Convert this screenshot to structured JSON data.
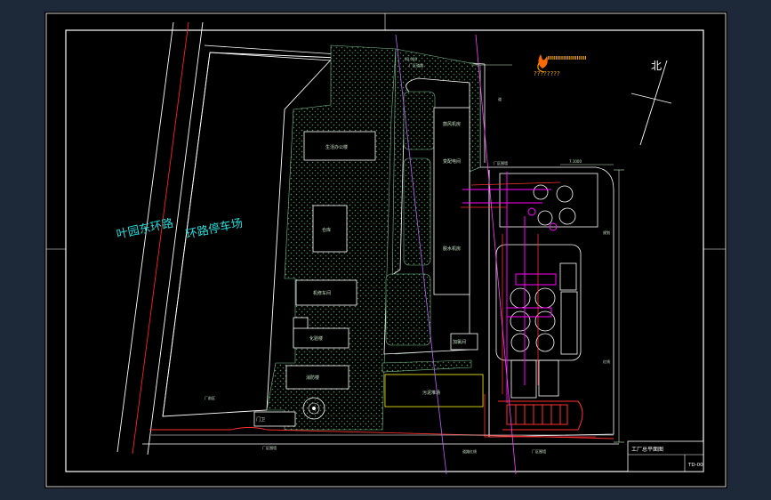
{
  "colors": {
    "frame": "#ffffff",
    "road_text": "#22dcdc",
    "magenta": "#ff00ff",
    "red": "#ff3030",
    "green": "#00d000",
    "yellow": "#e8e000",
    "hatch": "#59a86a"
  },
  "title_block": {
    "title": "工厂总平面图",
    "code": "TD-00"
  },
  "legend_mark": {
    "text": "????????"
  },
  "north_label": "北",
  "road_label": "叶园东环路",
  "parking_label": "环路停车场",
  "icons": [
    "logo-flame-icon",
    "north-arrow-icon",
    "fountain-icon"
  ]
}
